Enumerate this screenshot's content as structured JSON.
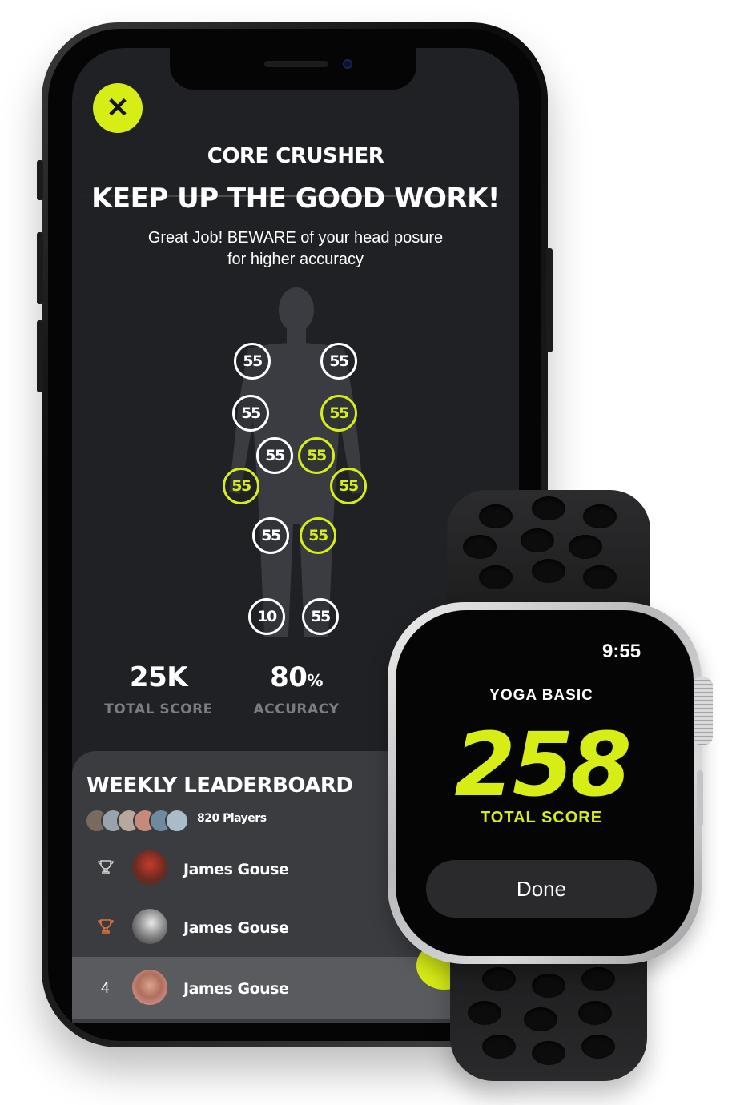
{
  "phone": {
    "workout_title": "CORE CRUSHER",
    "headline": "KEEP UP THE GOOD WORK!",
    "message_line1": "Great Job! BEWARE of your head posure",
    "message_line2": "for higher accuracy",
    "body_scores": [
      {
        "value": "55",
        "highlight": false
      },
      {
        "value": "55",
        "highlight": false
      },
      {
        "value": "55",
        "highlight": false
      },
      {
        "value": "55",
        "highlight": true
      },
      {
        "value": "55",
        "highlight": false
      },
      {
        "value": "55",
        "highlight": true
      },
      {
        "value": "55",
        "highlight": true
      },
      {
        "value": "55",
        "highlight": true
      },
      {
        "value": "55",
        "highlight": false
      },
      {
        "value": "55",
        "highlight": true
      },
      {
        "value": "10",
        "highlight": false
      },
      {
        "value": "55",
        "highlight": false
      }
    ],
    "stats": {
      "total_score_value": "25K",
      "total_score_label": "TOTAL SCORE",
      "accuracy_value": "80",
      "accuracy_unit": "%",
      "accuracy_label": "ACCURACY"
    },
    "leaderboard": {
      "title": "WEEKLY LEADERBOARD",
      "players_count": "820 Players",
      "rows": [
        {
          "rank_icon": "trophy-silver-icon",
          "name": "James Gouse"
        },
        {
          "rank_icon": "trophy-bronze-icon",
          "name": "James Gouse"
        },
        {
          "rank": "4",
          "name": "James Gouse"
        }
      ]
    }
  },
  "watch": {
    "time": "9:55",
    "workout_title": "YOGA BASIC",
    "score": "258",
    "score_label": "TOTAL SCORE",
    "done_label": "Done"
  },
  "colors": {
    "accent": "#d7ed16",
    "screen_bg": "#202124",
    "card_bg": "#3b3c40",
    "muted_text": "#7b7c80"
  }
}
